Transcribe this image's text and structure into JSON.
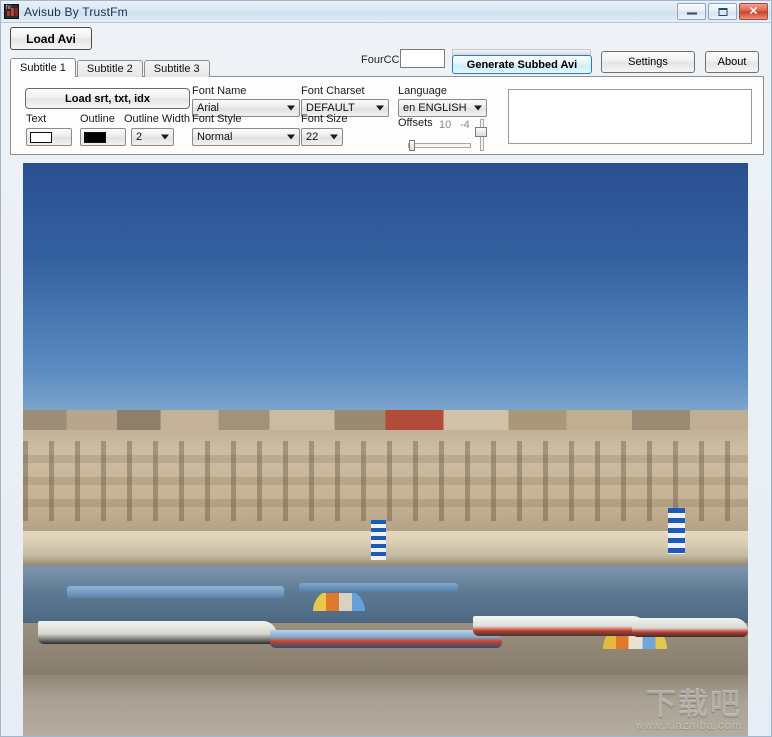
{
  "window": {
    "title": "Avisub By TrustFm",
    "icon": "app-icon",
    "caption": {
      "minimize": "minimize-icon",
      "maximize": "maximize-icon",
      "close": "✕"
    }
  },
  "toolbar": {
    "load_avi_label": "Load Avi",
    "fourcc_label": "FourCC",
    "fourcc_value": "",
    "fourcc_placeholder": "",
    "generate_label": "Generate Subbed Avi",
    "settings_label": "Settings",
    "about_label": "About",
    "progress_value": 0
  },
  "tabs": [
    {
      "label": "Subtitle 1",
      "active": true
    },
    {
      "label": "Subtitle 2",
      "active": false
    },
    {
      "label": "Subtitle 3",
      "active": false
    }
  ],
  "panel": {
    "load_sub_label": "Load srt, txt, idx",
    "fields": {
      "text_label": "Text",
      "text_value": "",
      "text_color": "#ffffff",
      "outline_label": "Outline",
      "outline_value": "",
      "outline_color": "#000000",
      "outline_width_label": "Outline Width",
      "outline_width_value": "2",
      "font_name_label": "Font Name",
      "font_name_value": "Arial",
      "font_style_label": "Font Style",
      "font_style_value": "Normal",
      "font_charset_label": "Font Charset",
      "font_charset_value": "DEFAULT",
      "font_size_label": "Font Size",
      "font_size_value": "22",
      "language_label": "Language",
      "language_value": "en ENGLISH",
      "offsets_label": "Offsets",
      "offset_x": "10",
      "offset_y": "-4",
      "subtitle_text": ""
    }
  },
  "preview": {
    "alt": "harbour-town-photo",
    "watermark_main": "下载吧",
    "watermark_sub": "www.xiazaiba.com"
  }
}
